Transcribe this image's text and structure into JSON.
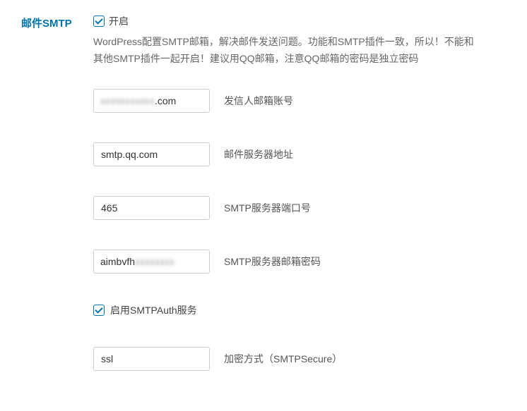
{
  "section": {
    "title": "邮件SMTP",
    "enable_label": "开启",
    "enabled": true,
    "description": "WordPress配置SMTP邮箱，解决邮件发送问题。功能和SMTP插件一致，所以！不能和其他SMTP插件一起开启！建议用QQ邮箱，注意QQ邮箱的密码是独立密码"
  },
  "fields": {
    "sender_email": {
      "value_clear_suffix": ".com",
      "label": "发信人邮箱账号"
    },
    "server": {
      "value": "smtp.qq.com",
      "label": "邮件服务器地址"
    },
    "port": {
      "value": "465",
      "label": "SMTP服务器端口号"
    },
    "password": {
      "value_clear_prefix": "aimbvfh",
      "label": "SMTP服务器邮箱密码"
    },
    "smtp_auth": {
      "checked": true,
      "label": "启用SMTPAuth服务"
    },
    "secure": {
      "value": "ssl",
      "label": "加密方式（SMTPSecure）"
    }
  }
}
